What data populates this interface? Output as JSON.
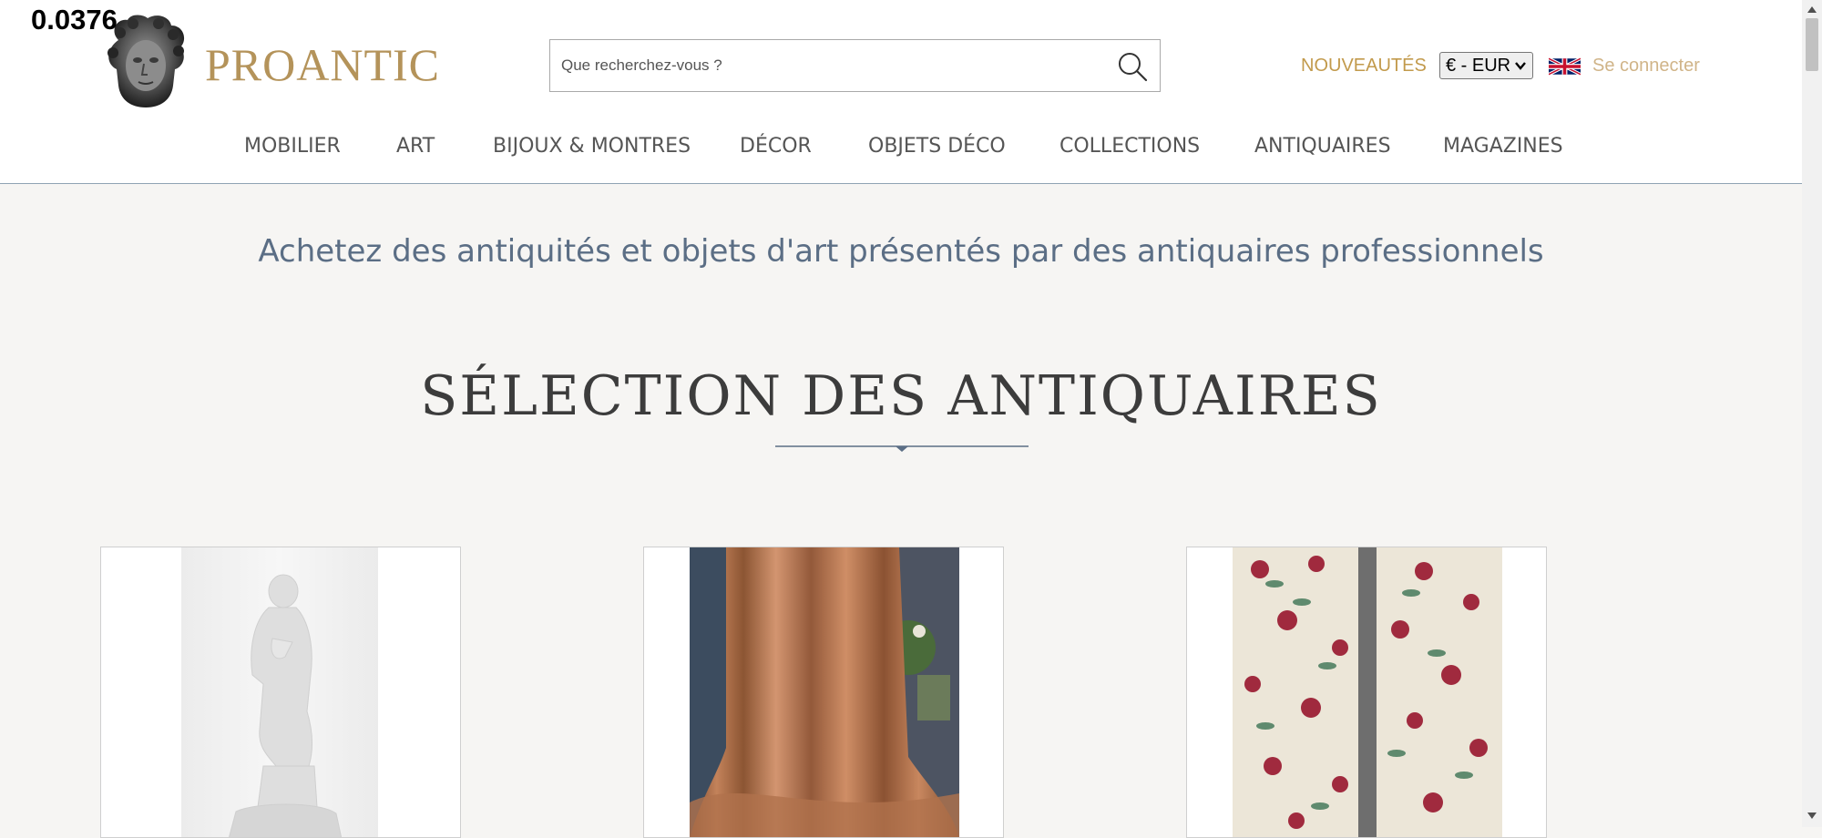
{
  "overlay_value": "0.0376",
  "header": {
    "logo_text": "PROANTIC",
    "search": {
      "placeholder": "Que recherchez-vous ?"
    },
    "nouveautes": "NOUVEAUTÉS",
    "currency": "€ - EUR",
    "login": "Se connecter",
    "icons": {
      "logo": "bust-logo-icon",
      "search": "magnifier-icon",
      "flag": "uk-flag-icon",
      "dropdown": "chevron-down-icon"
    }
  },
  "nav": {
    "items": [
      "MOBILIER",
      "ART",
      "BIJOUX & MONTRES",
      "DÉCOR",
      "OBJETS DÉCO",
      "COLLECTIONS",
      "ANTIQUAIRES",
      "MAGAZINES"
    ]
  },
  "main": {
    "tagline": "Achetez des antiquités et objets d'art présentés par des antiquaires professionnels",
    "section_title": "SÉLECTION DES ANTIQUAIRES"
  },
  "colors": {
    "brand_gold": "#b4935a",
    "nav_text": "#555555",
    "tagline_blue": "#5b6e85",
    "divider_blue": "#5b6e85",
    "page_bg": "#f6f5f3"
  }
}
